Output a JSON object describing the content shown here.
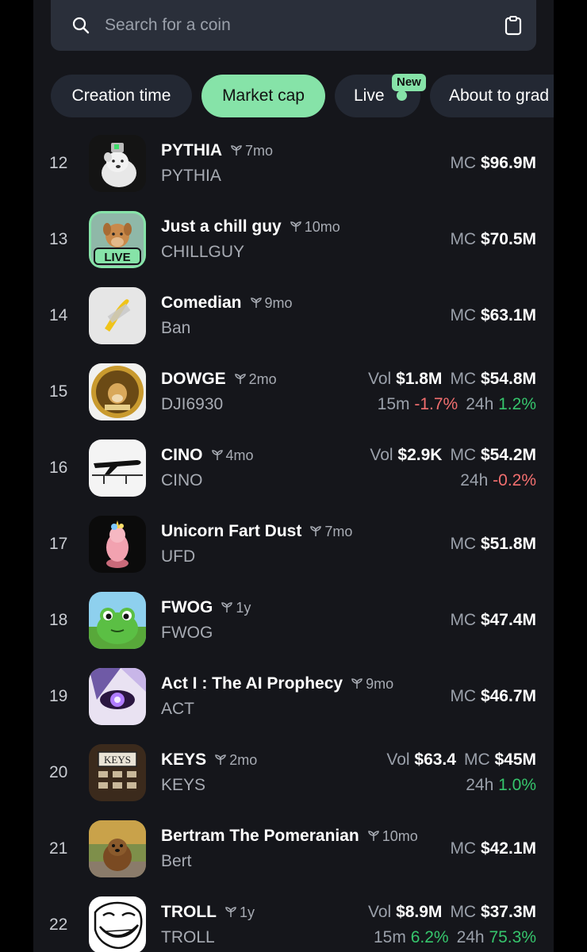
{
  "search": {
    "placeholder": "Search for a coin"
  },
  "filters": {
    "creation": "Creation time",
    "market": "Market cap",
    "live": "Live",
    "new_badge": "New",
    "grad": "About to grad"
  },
  "coins": [
    {
      "rank": "12",
      "name": "PYTHIA",
      "age": "7mo",
      "ticker": "PYTHIA",
      "mc": "$96.9M"
    },
    {
      "rank": "13",
      "name": "Just a chill guy",
      "age": "10mo",
      "ticker": "CHILLGUY",
      "mc": "$70.5M",
      "live_tag": "LIVE"
    },
    {
      "rank": "14",
      "name": "Comedian",
      "age": "9mo",
      "ticker": "Ban",
      "mc": "$63.1M"
    },
    {
      "rank": "15",
      "name": "DOWGE",
      "age": "2mo",
      "ticker": "DJI6930",
      "vol": "$1.8M",
      "mc": "$54.8M",
      "m15": "-1.7%",
      "h24": "1.2%"
    },
    {
      "rank": "16",
      "name": "CINO",
      "age": "4mo",
      "ticker": "CINO",
      "vol": "$2.9K",
      "mc": "$54.2M",
      "h24": "-0.2%"
    },
    {
      "rank": "17",
      "name": "Unicorn Fart Dust",
      "age": "7mo",
      "ticker": "UFD",
      "mc": "$51.8M"
    },
    {
      "rank": "18",
      "name": "FWOG",
      "age": "1y",
      "ticker": "FWOG",
      "mc": "$47.4M"
    },
    {
      "rank": "19",
      "name": "Act I : The AI Prophecy",
      "age": "9mo",
      "ticker": "ACT",
      "mc": "$46.7M"
    },
    {
      "rank": "20",
      "name": "KEYS",
      "age": "2mo",
      "ticker": "KEYS",
      "vol": "$63.4",
      "mc": "$45M",
      "h24": "1.0%"
    },
    {
      "rank": "21",
      "name": "Bertram The Pomeranian",
      "age": "10mo",
      "ticker": "Bert",
      "mc": "$42.1M"
    },
    {
      "rank": "22",
      "name": "TROLL",
      "age": "1y",
      "ticker": "TROLL",
      "vol": "$8.9M",
      "mc": "$37.3M",
      "m15": "6.2%",
      "h24": "75.3%"
    }
  ],
  "labels": {
    "mc": "MC",
    "vol": "Vol",
    "m15": "15m",
    "h24": "24h",
    "keys_img": "KEYS"
  },
  "colors": {
    "accent": "#86e3a8",
    "negative": "#f26f6f",
    "positive": "#36c56c",
    "background": "#15161b"
  }
}
